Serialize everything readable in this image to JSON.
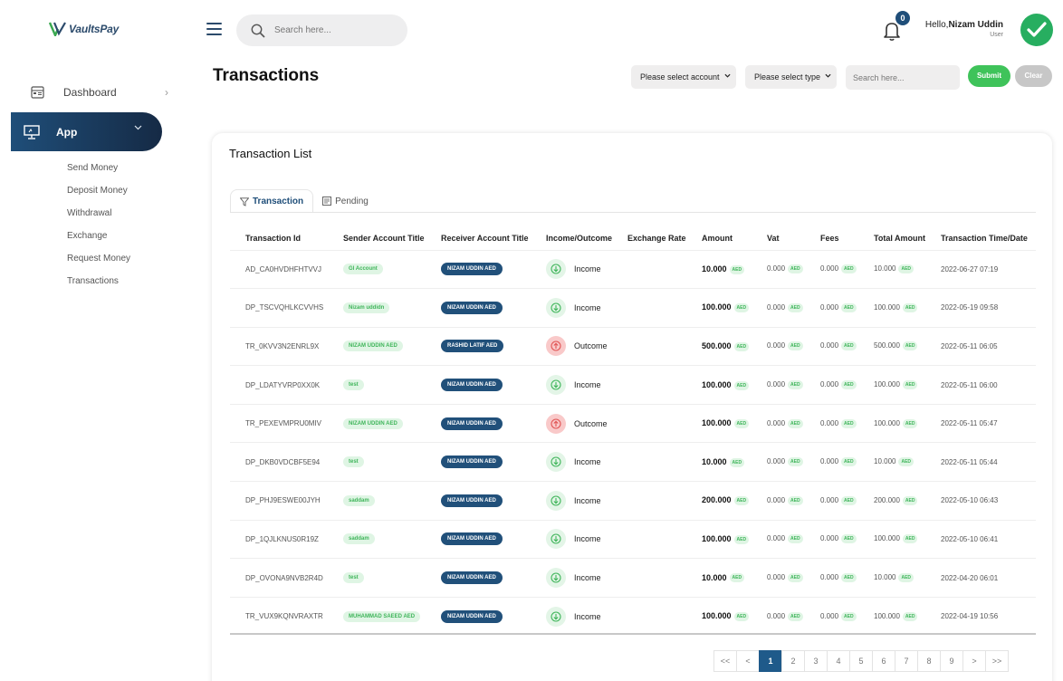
{
  "brand": {
    "name": "VaultsPay"
  },
  "sidebar": {
    "dashboard_label": "Dashboard",
    "app_label": "App",
    "subitems": [
      "Send Money",
      "Deposit Money",
      "Withdrawal",
      "Exchange",
      "Request Money",
      "Transactions"
    ]
  },
  "header": {
    "search_placeholder": "Search here...",
    "notification_count": "0",
    "greeting": "Hello,",
    "user_name": "Nizam Uddin",
    "user_role": "User"
  },
  "page": {
    "title": "Transactions",
    "filters": {
      "account_select": "Please select account",
      "type_select": "Please select type",
      "search_placeholder": "Search here...",
      "submit_label": "Submit",
      "clear_label": "Clear"
    }
  },
  "card": {
    "title": "Transaction List",
    "tabs": [
      {
        "label": "Transaction",
        "icon": "filter-icon",
        "active": true
      },
      {
        "label": "Pending",
        "icon": "list-icon",
        "active": false
      }
    ]
  },
  "table": {
    "columns": [
      "Transaction Id",
      "Sender Account Title",
      "Receiver Account Title",
      "Income/Outcome",
      "Exchange Rate",
      "Amount",
      "Vat",
      "Fees",
      "Total Amount",
      "Transaction Time/Date"
    ],
    "currency": "AED",
    "rows": [
      {
        "id": "AD_CA0HVDHFHTVVJ",
        "sender": "GI Account",
        "receiver": "NIZAM UDDIN AED",
        "type": "Income",
        "rate": "",
        "amount": "10.000",
        "vat": "0.000",
        "fees": "0.000",
        "total": "10.000",
        "date": "2022-06-27 07:19"
      },
      {
        "id": "DP_TSCVQHLKCVVHS",
        "sender": "Nizam uddidn",
        "receiver": "NIZAM UDDIN AED",
        "type": "Income",
        "rate": "",
        "amount": "100.000",
        "vat": "0.000",
        "fees": "0.000",
        "total": "100.000",
        "date": "2022-05-19 09:58"
      },
      {
        "id": "TR_0KVV3N2ENRL9X",
        "sender": "NIZAM UDDIN AED",
        "receiver": "RASHID LATIF AED",
        "type": "Outcome",
        "rate": "",
        "amount": "500.000",
        "vat": "0.000",
        "fees": "0.000",
        "total": "500.000",
        "date": "2022-05-11 06:05"
      },
      {
        "id": "DP_LDATYVRP0XX0K",
        "sender": "test",
        "receiver": "NIZAM UDDIN AED",
        "type": "Income",
        "rate": "",
        "amount": "100.000",
        "vat": "0.000",
        "fees": "0.000",
        "total": "100.000",
        "date": "2022-05-11 06:00"
      },
      {
        "id": "TR_PEXEVMPRU0MIV",
        "sender": "NIZAM UDDIN AED",
        "receiver": "NIZAM UDDIN AED",
        "type": "Outcome",
        "rate": "",
        "amount": "100.000",
        "vat": "0.000",
        "fees": "0.000",
        "total": "100.000",
        "date": "2022-05-11 05:47"
      },
      {
        "id": "DP_DKB0VDCBF5E94",
        "sender": "test",
        "receiver": "NIZAM UDDIN AED",
        "type": "Income",
        "rate": "",
        "amount": "10.000",
        "vat": "0.000",
        "fees": "0.000",
        "total": "10.000",
        "date": "2022-05-11 05:44"
      },
      {
        "id": "DP_PHJ9ESWE00JYH",
        "sender": "saddam",
        "receiver": "NIZAM UDDIN AED",
        "type": "Income",
        "rate": "",
        "amount": "200.000",
        "vat": "0.000",
        "fees": "0.000",
        "total": "200.000",
        "date": "2022-05-10 06:43"
      },
      {
        "id": "DP_1QJLKNUS0R19Z",
        "sender": "saddam",
        "receiver": "NIZAM UDDIN AED",
        "type": "Income",
        "rate": "",
        "amount": "100.000",
        "vat": "0.000",
        "fees": "0.000",
        "total": "100.000",
        "date": "2022-05-10 06:41"
      },
      {
        "id": "DP_OVONA9NVB2R4D",
        "sender": "test",
        "receiver": "NIZAM UDDIN AED",
        "type": "Income",
        "rate": "",
        "amount": "10.000",
        "vat": "0.000",
        "fees": "0.000",
        "total": "10.000",
        "date": "2022-04-20 06:01"
      },
      {
        "id": "TR_VUX9KQNVRAXTR",
        "sender": "MUHAMMAD SAEED AED",
        "receiver": "NIZAM UDDIN AED",
        "type": "Income",
        "rate": "",
        "amount": "100.000",
        "vat": "0.000",
        "fees": "0.000",
        "total": "100.000",
        "date": "2022-04-19 10:56"
      }
    ]
  },
  "pagination": {
    "items": [
      "<<",
      "<",
      "1",
      "2",
      "3",
      "4",
      "5",
      "6",
      "7",
      "8",
      "9",
      ">",
      ">>"
    ],
    "active": "1"
  },
  "colors": {
    "navy": "#1f4e79",
    "green": "#3fc35a",
    "outcome": "#e15555"
  }
}
